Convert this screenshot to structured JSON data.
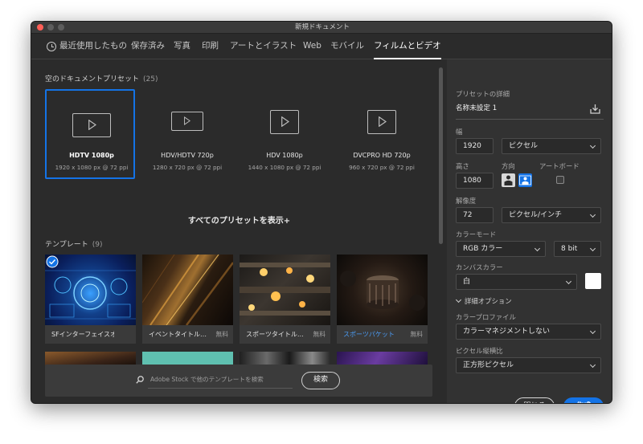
{
  "window": {
    "title": "新規ドキュメント"
  },
  "tabs": [
    {
      "label": "最近使用したもの",
      "active": false
    },
    {
      "label": "保存済み",
      "active": false
    },
    {
      "label": "写真",
      "active": false
    },
    {
      "label": "印刷",
      "active": false
    },
    {
      "label": "アートとイラスト",
      "active": false
    },
    {
      "label": "Web",
      "active": false
    },
    {
      "label": "モバイル",
      "active": false
    },
    {
      "label": "フィルムとビデオ",
      "active": true
    }
  ],
  "presets_section": {
    "title": "空のドキュメントプリセット",
    "count": "(25)"
  },
  "presets": [
    {
      "name": "HDTV 1080p",
      "size": "1920 x 1080 px @ 72 ppi",
      "selected": true
    },
    {
      "name": "HDV/HDTV 720p",
      "size": "1280 x 720 px @ 72 ppi",
      "selected": false
    },
    {
      "name": "HDV 1080p",
      "size": "1440 x 1080 px @ 72 ppi",
      "selected": false
    },
    {
      "name": "DVCPRO HD 720p",
      "size": "960 x 720 px @ 72 ppi",
      "selected": false
    }
  ],
  "show_all": "すべてのプリセットを表示+",
  "templates_section": {
    "title": "テンプレート",
    "count": "(9)"
  },
  "templates": [
    {
      "name": "SFインターフェイスオ…",
      "price": "",
      "link": false
    },
    {
      "name": "イベントタイトル…",
      "price": "無料",
      "link": false
    },
    {
      "name": "スポーツタイトル…",
      "price": "無料",
      "link": false
    },
    {
      "name": "スポーツパケット",
      "price": "無料",
      "link": true
    }
  ],
  "search": {
    "placeholder": "Adobe Stock で他のテンプレートを検索",
    "button": "検索"
  },
  "details": {
    "title": "プリセットの詳細",
    "doc_name": "名称未設定 1",
    "width_label": "幅",
    "width_value": "1920",
    "width_unit": "ピクセル",
    "height_label": "高さ",
    "height_value": "1080",
    "orientation_label": "方向",
    "artboard_label": "アートボード",
    "resolution_label": "解像度",
    "resolution_value": "72",
    "resolution_unit": "ピクセル/インチ",
    "color_mode_label": "カラーモード",
    "color_mode_value": "RGB カラー",
    "bit_depth": "8 bit",
    "canvas_color_label": "カンバスカラー",
    "canvas_color_value": "白",
    "advanced_label": "詳細オプション",
    "color_profile_label": "カラープロファイル",
    "color_profile_value": "カラーマネジメントしない",
    "pixel_aspect_label": "ピクセル縦横比",
    "pixel_aspect_value": "正方形ピクセル"
  },
  "buttons": {
    "close": "閉じる",
    "create": "作成"
  },
  "colors": {
    "accent": "#1473e6",
    "background": "#2b2b2b",
    "panel": "#323232"
  }
}
